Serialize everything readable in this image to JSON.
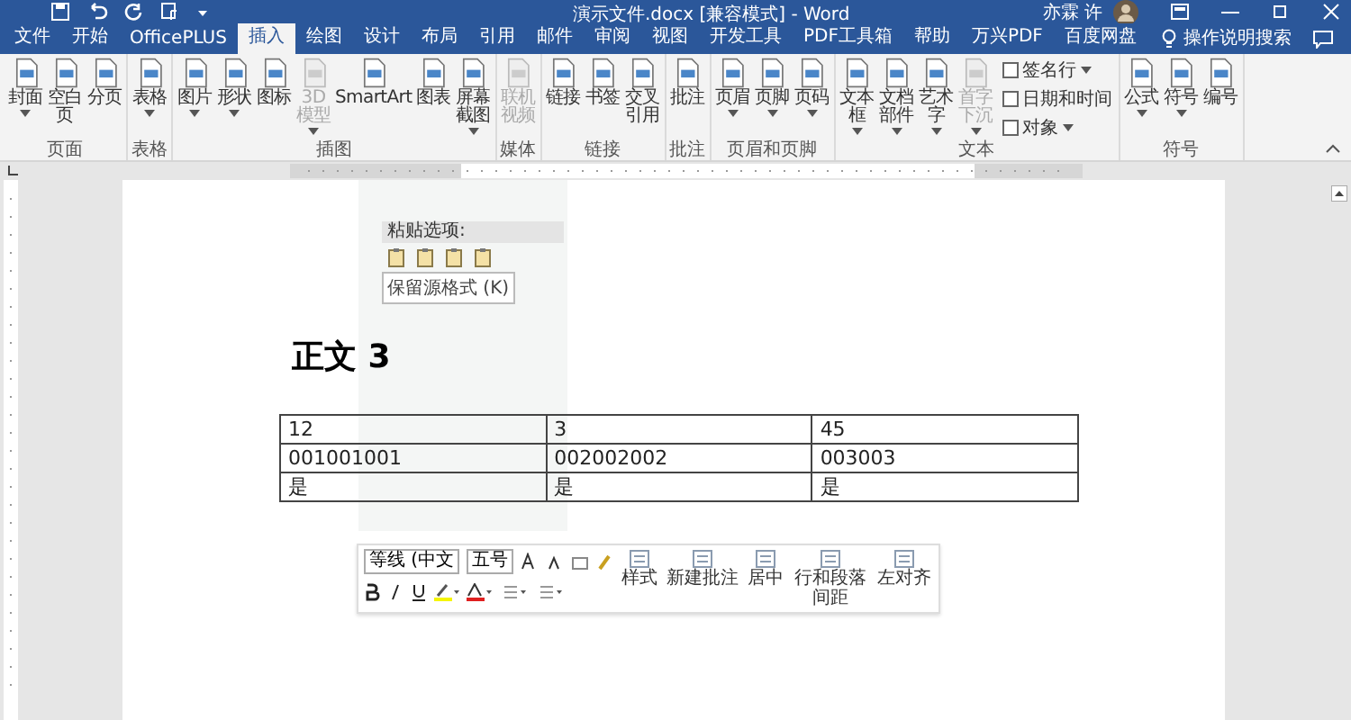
{
  "title_bar": {
    "title": "演示文件.docx [兼容模式] - Word",
    "user": "亦霖 许"
  },
  "tabs": [
    {
      "label": "文件",
      "selected": false
    },
    {
      "label": "开始",
      "selected": false
    },
    {
      "label": "OfficePLUS",
      "selected": false
    },
    {
      "label": "插入",
      "selected": true
    },
    {
      "label": "绘图",
      "selected": false
    },
    {
      "label": "设计",
      "selected": false
    },
    {
      "label": "布局",
      "selected": false
    },
    {
      "label": "引用",
      "selected": false
    },
    {
      "label": "邮件",
      "selected": false
    },
    {
      "label": "审阅",
      "selected": false
    },
    {
      "label": "视图",
      "selected": false
    },
    {
      "label": "开发工具",
      "selected": false
    },
    {
      "label": "PDF工具箱",
      "selected": false
    },
    {
      "label": "帮助",
      "selected": false
    },
    {
      "label": "万兴PDF",
      "selected": false
    },
    {
      "label": "百度网盘",
      "selected": false
    }
  ],
  "tell_me": {
    "placeholder": "操作说明搜索"
  },
  "ribbon": [
    {
      "label": "页面",
      "buttons": [
        {
          "kind": "large",
          "label": "封面",
          "disabled": false,
          "dropdown": true
        },
        {
          "kind": "large",
          "label": "空白页",
          "disabled": false,
          "dropdown": false
        },
        {
          "kind": "large",
          "label": "分页",
          "disabled": false,
          "dropdown": false
        }
      ]
    },
    {
      "label": "表格",
      "buttons": [
        {
          "kind": "large",
          "label": "表格",
          "disabled": false,
          "dropdown": true
        }
      ]
    },
    {
      "label": "插图",
      "buttons": [
        {
          "kind": "large",
          "label": "图片",
          "disabled": false,
          "dropdown": true
        },
        {
          "kind": "large",
          "label": "形状",
          "disabled": false,
          "dropdown": true
        },
        {
          "kind": "large",
          "label": "图标",
          "disabled": false,
          "dropdown": false
        },
        {
          "kind": "large",
          "label": "3D 模型",
          "disabled": true,
          "dropdown": true
        },
        {
          "kind": "large",
          "label": "SmartArt",
          "disabled": false,
          "dropdown": false
        },
        {
          "kind": "large",
          "label": "图表",
          "disabled": false,
          "dropdown": false
        },
        {
          "kind": "large",
          "label": "屏幕截图",
          "disabled": false,
          "dropdown": true
        }
      ]
    },
    {
      "label": "媒体",
      "buttons": [
        {
          "kind": "large",
          "label": "联机视频",
          "disabled": true,
          "dropdown": false
        }
      ]
    },
    {
      "label": "链接",
      "buttons": [
        {
          "kind": "large",
          "label": "链接",
          "disabled": false,
          "dropdown": false
        },
        {
          "kind": "large",
          "label": "书签",
          "disabled": false,
          "dropdown": false
        },
        {
          "kind": "large",
          "label": "交叉引用",
          "disabled": false,
          "dropdown": false
        }
      ]
    },
    {
      "label": "批注",
      "buttons": [
        {
          "kind": "large",
          "label": "批注",
          "disabled": false,
          "dropdown": false
        }
      ]
    },
    {
      "label": "页眉和页脚",
      "buttons": [
        {
          "kind": "large",
          "label": "页眉",
          "disabled": false,
          "dropdown": true
        },
        {
          "kind": "large",
          "label": "页脚",
          "disabled": false,
          "dropdown": true
        },
        {
          "kind": "large",
          "label": "页码",
          "disabled": false,
          "dropdown": true
        }
      ]
    },
    {
      "label": "文本",
      "buttons": [
        {
          "kind": "large",
          "label": "文本框",
          "disabled": false,
          "dropdown": true
        },
        {
          "kind": "large",
          "label": "文档部件",
          "disabled": false,
          "dropdown": true
        },
        {
          "kind": "large",
          "label": "艺术字",
          "disabled": false,
          "dropdown": true
        },
        {
          "kind": "large",
          "label": "首字下沉",
          "disabled": true,
          "dropdown": true
        },
        {
          "kind": "small",
          "label": "签名行",
          "disabled": false,
          "dropdown": true
        },
        {
          "kind": "small",
          "label": "日期和时间",
          "disabled": false,
          "dropdown": false
        },
        {
          "kind": "small",
          "label": "对象",
          "disabled": false,
          "dropdown": true
        }
      ]
    },
    {
      "label": "符号",
      "buttons": [
        {
          "kind": "large",
          "label": "公式",
          "disabled": false,
          "dropdown": true
        },
        {
          "kind": "large",
          "label": "符号",
          "disabled": false,
          "dropdown": true
        },
        {
          "kind": "large",
          "label": "编号",
          "disabled": false,
          "dropdown": false
        }
      ]
    }
  ],
  "paste_options": {
    "title": "粘贴选项:",
    "tooltip": "保留源格式 (K)"
  },
  "heading": "正文 3",
  "table": {
    "rows": [
      [
        "12",
        "3",
        "45"
      ],
      [
        "001001001",
        "002002002",
        "003003"
      ],
      [
        "是",
        "是",
        "是"
      ]
    ]
  },
  "mini_toolbar": {
    "font": "等线 (中文",
    "size": "五号",
    "buttons": [
      "样式",
      "新建批注",
      "居中",
      "行和段落间距",
      "左对齐"
    ]
  }
}
